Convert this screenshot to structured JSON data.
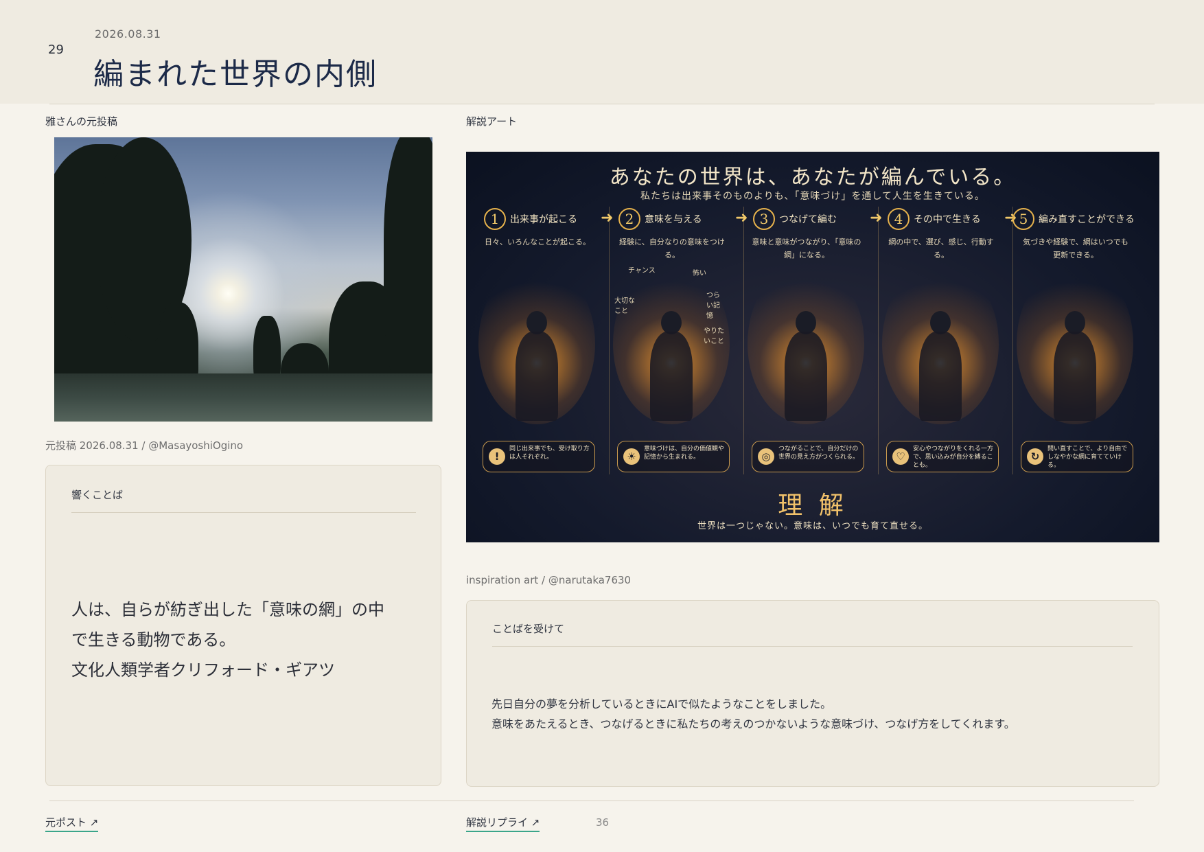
{
  "header": {
    "page_number": "29",
    "date": "2026.08.31",
    "title": "編まれた世界の内側"
  },
  "left": {
    "section_label": "雅さんの元投稿",
    "caption": "元投稿 2026.08.31 / @MasayoshiOgino",
    "card": {
      "title": "響くことば",
      "quote_lines": [
        "人は、自らが紡ぎ出した「意味の網」の中",
        "で生きる動物である。",
        "文化人類学者クリフォード・ギアツ"
      ]
    },
    "link": "元ポスト ↗"
  },
  "right": {
    "section_label": "解説アート",
    "caption": "inspiration art / @narutaka7630",
    "art": {
      "title": "あなたの世界は、あなたが編んでいる。",
      "subtitle": "私たちは出来事そのものよりも、「意味づけ」を通して人生を生きている。",
      "steps": [
        {
          "num": "1",
          "name": "出来事が起こる",
          "desc": "日々、いろんなことが起こる。",
          "note": "同じ出来事でも、受け取り方は人それぞれ。",
          "icon": "exclamation-icon"
        },
        {
          "num": "2",
          "name": "意味を与える",
          "desc": "経験に、自分なりの意味をつける。",
          "note": "意味づけは、自分の価値観や記憶から生まれる。",
          "icon": "lightbulb-icon"
        },
        {
          "num": "3",
          "name": "つなげて編む",
          "desc": "意味と意味がつながり、「意味の網」になる。",
          "note": "つながることで、自分だけの世界の見え方がつくられる。",
          "icon": "yarn-icon"
        },
        {
          "num": "4",
          "name": "その中で生きる",
          "desc": "網の中で、選び、感じ、行動する。",
          "note": "安心やつながりをくれる一方で、思い込みが自分を縛ることも。",
          "icon": "heart-icon"
        },
        {
          "num": "5",
          "name": "編み直すことができる",
          "desc": "気づきや経験で、網はいつでも更新できる。",
          "note": "問い直すことで、より自由でしなやかな網に育てていける。",
          "icon": "refresh-icon"
        }
      ],
      "bubbles": [
        "チャンス",
        "怖い",
        "大切なこと",
        "つらい記憶",
        "やりたいこと"
      ],
      "footer_title": "理 解",
      "footer_sub": "世界は一つじゃない。意味は、いつでも育て直せる。"
    },
    "card": {
      "title": "ことばを受けて",
      "body_lines": [
        "先日自分の夢を分析しているときにAIで似たようなことをしました。",
        "意味をあたえるとき、つなげるときに私たちの考えのつかないような意味づけ、つなげ方をしてくれます。"
      ]
    },
    "link": "解説リプライ ↗",
    "count": "36"
  }
}
